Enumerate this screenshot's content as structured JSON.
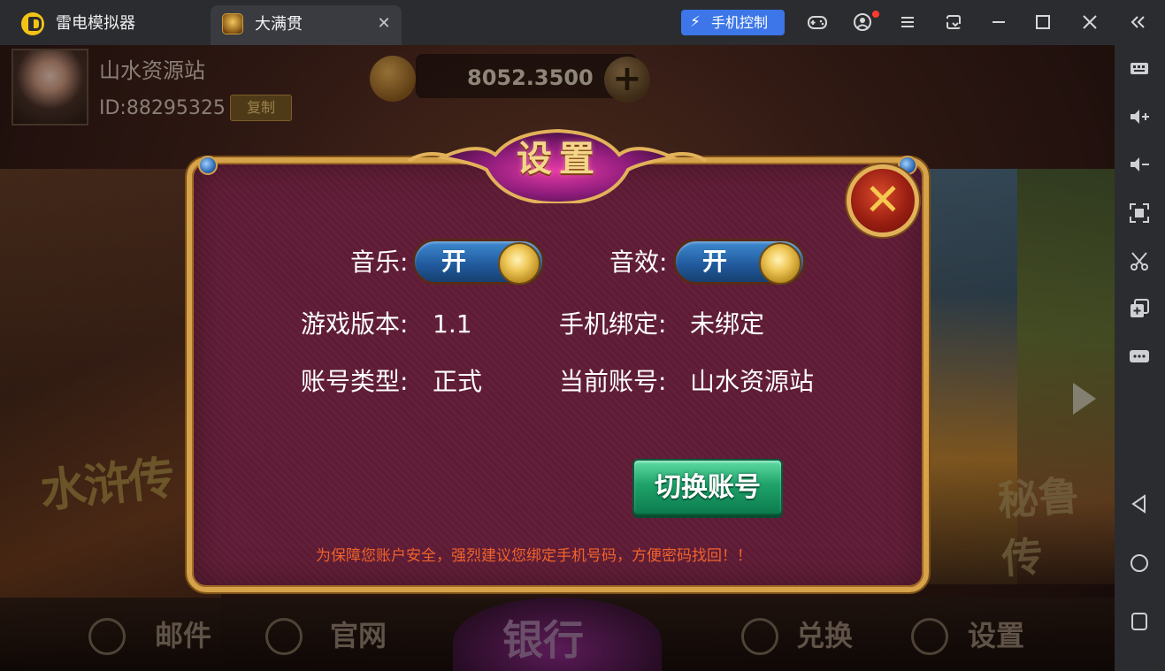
{
  "emulator": {
    "app_name": "雷电模拟器",
    "tab_title": "大满贯",
    "tab_close": "✕",
    "phone_control_label": "手机控制"
  },
  "game_bg": {
    "player_name": "山水资源站",
    "player_id": "ID:88295325",
    "copy_label": "复制",
    "coins": "8052.3500",
    "plus": "+",
    "left_game_title": "水浒传",
    "right_game_title": "秘鲁传",
    "bottom_nav": {
      "mail": "邮件",
      "website": "官网",
      "bank": "银行",
      "exchange": "兑换",
      "settings": "设置"
    }
  },
  "settings_dialog": {
    "title": "设置",
    "close_glyph": "✕",
    "music_label": "音乐:",
    "music_state": "开",
    "music_on": true,
    "sound_label": "音效:",
    "sound_state": "开",
    "sound_on": true,
    "version_label": "游戏版本:",
    "version_value": "1.1",
    "phone_bind_label": "手机绑定:",
    "phone_bind_value": "未绑定",
    "account_type_label": "账号类型:",
    "account_type_value": "正式",
    "current_account_label": "当前账号:",
    "current_account_value": "山水资源站",
    "switch_account_label": "切换账号",
    "warning": "为保障您账户安全，强烈建议您绑定手机号码，方便密码找回！！"
  },
  "colors": {
    "dialog_bg": "#64203a",
    "dialog_border": "#d6a24a",
    "toggle_blue": "#20589a",
    "switch_green": "#1fa36a",
    "warning_orange": "#f0632a",
    "phone_control_blue": "#3c76e8"
  }
}
